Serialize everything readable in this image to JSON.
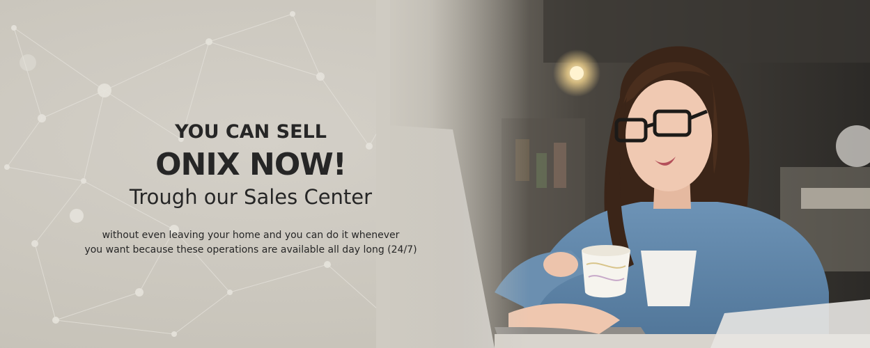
{
  "banner": {
    "headline_top": "YOU CAN SELL",
    "headline_main": "ONIX NOW!",
    "subheadline": "Trough our Sales Center",
    "body_line1": "without even leaving your home and you can do it whenever",
    "body_line2": "you want because these operations are available all day long (24/7)"
  },
  "colors": {
    "background": "#cfcbc2",
    "text": "#262626"
  }
}
